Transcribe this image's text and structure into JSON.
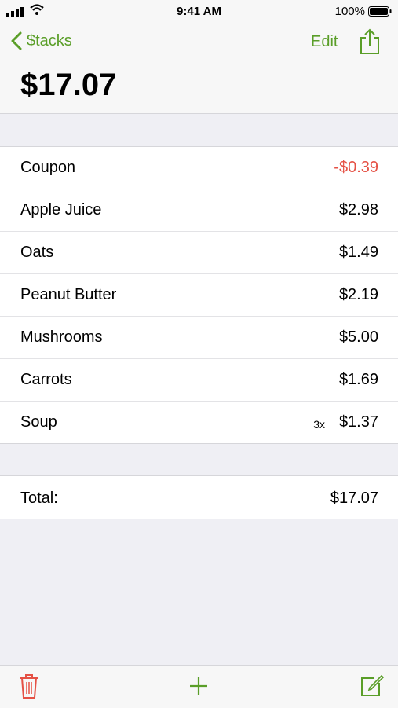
{
  "status_bar": {
    "time": "9:41 AM",
    "battery_percent": "100%",
    "icons": [
      "signal-icon",
      "wifi-icon",
      "battery-icon"
    ]
  },
  "nav": {
    "back_label": "$tacks",
    "edit_label": "Edit",
    "title": "$17.07",
    "icons": [
      "chevron-left-icon",
      "share-icon"
    ]
  },
  "items": [
    {
      "name": "Coupon",
      "quantity": "",
      "price": "-$0.39"
    },
    {
      "name": "Apple Juice",
      "quantity": "",
      "price": "$2.98"
    },
    {
      "name": "Oats",
      "quantity": "",
      "price": "$1.49"
    },
    {
      "name": "Peanut Butter",
      "quantity": "",
      "price": "$2.19"
    },
    {
      "name": "Mushrooms",
      "quantity": "",
      "price": "$5.00"
    },
    {
      "name": "Carrots",
      "quantity": "",
      "price": "$1.69"
    },
    {
      "name": "Soup",
      "quantity": "3x",
      "price": "$1.37"
    }
  ],
  "total": {
    "label": "Total:",
    "value": "$17.07"
  },
  "toolbar": {
    "icons": [
      "trash-icon",
      "plus-icon",
      "compose-icon"
    ]
  },
  "colors": {
    "accent": "#5a9e28",
    "negative": "#e55145",
    "trash": "#e55145",
    "background": "#efeff4"
  }
}
